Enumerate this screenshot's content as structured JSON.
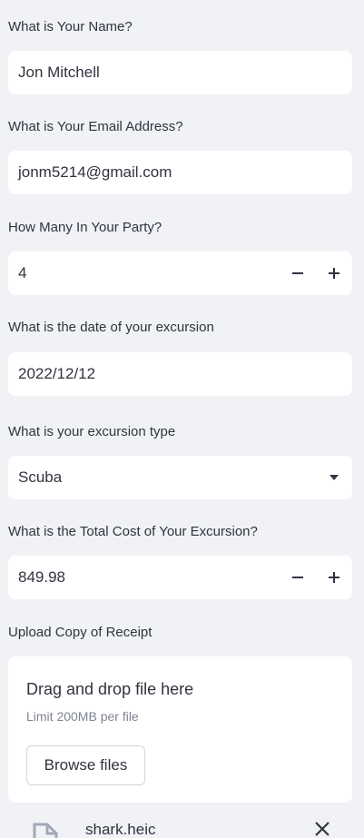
{
  "name_field": {
    "label": "What is Your Name?",
    "value": "Jon Mitchell"
  },
  "email_field": {
    "label": "What is Your Email Address?",
    "value": "jonm5214@gmail.com"
  },
  "party_field": {
    "label": "How Many In Your Party?",
    "value": "4",
    "decrement_icon": "minus-icon",
    "increment_icon": "plus-icon"
  },
  "date_field": {
    "label": "What is the date of your excursion",
    "value": "2022/12/12"
  },
  "type_field": {
    "label": "What is your excursion type",
    "value": "Scuba",
    "caret_icon": "caret-down-icon"
  },
  "cost_field": {
    "label": "What is the Total Cost of Your Excursion?",
    "value": "849.98",
    "decrement_icon": "minus-icon",
    "increment_icon": "plus-icon"
  },
  "upload": {
    "label": "Upload Copy of Receipt",
    "drop_title": "Drag and drop file here",
    "limit_text": "Limit 200MB per file",
    "browse_label": "Browse files",
    "file": {
      "name": "shark.heic",
      "icon": "file-icon",
      "remove_icon": "close-icon"
    }
  },
  "colors": {
    "background": "#f0f2f6",
    "field": "#ffffff",
    "text": "#31333f",
    "muted": "#808495"
  }
}
